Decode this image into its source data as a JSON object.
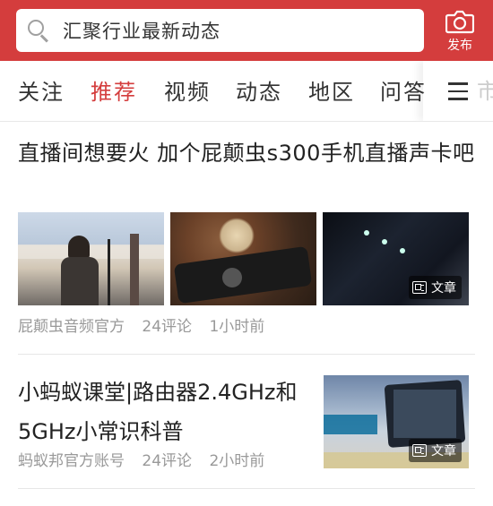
{
  "header": {
    "search_placeholder": "汇聚行业最新动态",
    "publish_label": "发布",
    "accent_color": "#d43d3d",
    "search_icon": "search-icon",
    "publish_icon": "camera-icon"
  },
  "tabs": {
    "items": [
      "关注",
      "推荐",
      "视频",
      "动态",
      "地区",
      "问答"
    ],
    "active": "推荐",
    "overflow_char": "市",
    "menu_icon": "menu-icon"
  },
  "articles": [
    {
      "title": "直播间想要火 加个屁颠虫s300手机直播声卡吧",
      "source": "屁颠虫音频官方",
      "comments": "24评论",
      "time": "1小时前",
      "badge": "文章"
    },
    {
      "title": "小蚂蚁课堂|路由器2.4GHz和5GHz小常识科普",
      "source": "蚂蚁邦官方账号",
      "comments": "24评论",
      "time": "2小时前",
      "badge": "文章"
    }
  ]
}
